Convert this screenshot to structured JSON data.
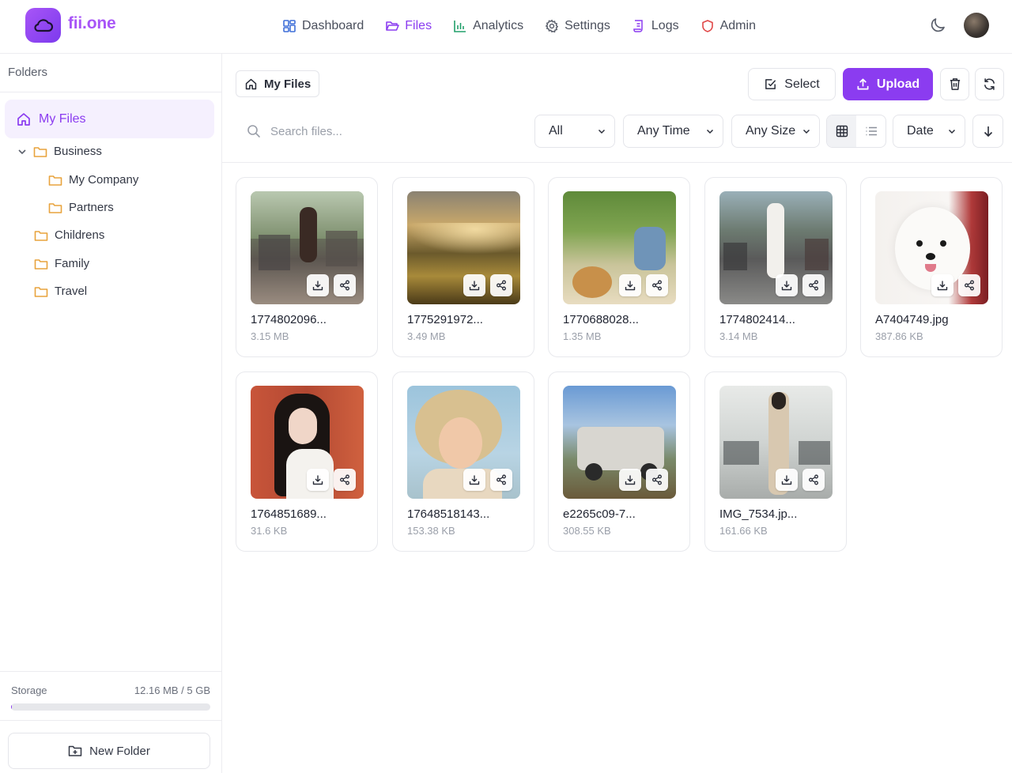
{
  "brand": {
    "name": "fii.one",
    "color": "#a855f7",
    "logo_icon": "cloud-icon"
  },
  "nav": [
    {
      "label": "Dashboard",
      "icon": "dashboard-icon",
      "active": false
    },
    {
      "label": "Files",
      "icon": "folder-open-icon",
      "active": true
    },
    {
      "label": "Analytics",
      "icon": "bar-chart-icon",
      "active": false
    },
    {
      "label": "Settings",
      "icon": "gear-icon",
      "active": false
    },
    {
      "label": "Logs",
      "icon": "scroll-icon",
      "active": false
    },
    {
      "label": "Admin",
      "icon": "shield-icon",
      "active": false
    }
  ],
  "sidebar": {
    "title": "Folders",
    "root": {
      "label": "My Files",
      "icon": "home-icon"
    },
    "folders": [
      {
        "label": "Business",
        "expanded": true
      },
      {
        "label": "My Company"
      },
      {
        "label": "Partners"
      },
      {
        "label": "Childrens"
      },
      {
        "label": "Family"
      },
      {
        "label": "Travel"
      }
    ],
    "storage": {
      "label": "Storage",
      "used_text": "12.16 MB / 5 GB",
      "used_fraction": 0.0024
    },
    "new_folder_label": "New Folder"
  },
  "toolbar": {
    "breadcrumb": "My Files",
    "select_label": "Select",
    "upload_label": "Upload",
    "search_placeholder": "Search files...",
    "filter_type": "All",
    "filter_time": "Any Time",
    "filter_size": "Any Size",
    "sort_by": "Date",
    "view": "grid"
  },
  "files": [
    {
      "name": "1774802096...",
      "size": "3.15 MB"
    },
    {
      "name": "1775291972...",
      "size": "3.49 MB"
    },
    {
      "name": "1770688028...",
      "size": "1.35 MB"
    },
    {
      "name": "1774802414...",
      "size": "3.14 MB"
    },
    {
      "name": "A7404749.jpg",
      "size": "387.86 KB"
    },
    {
      "name": "1764851689...",
      "size": "31.6 KB"
    },
    {
      "name": "17648518143...",
      "size": "153.38 KB"
    },
    {
      "name": "e2265c09-7...",
      "size": "308.55 KB"
    },
    {
      "name": "IMG_7534.jp...",
      "size": "161.66 KB"
    }
  ],
  "colors": {
    "accent": "#8b3cf0",
    "folder": "#e8a33d"
  }
}
